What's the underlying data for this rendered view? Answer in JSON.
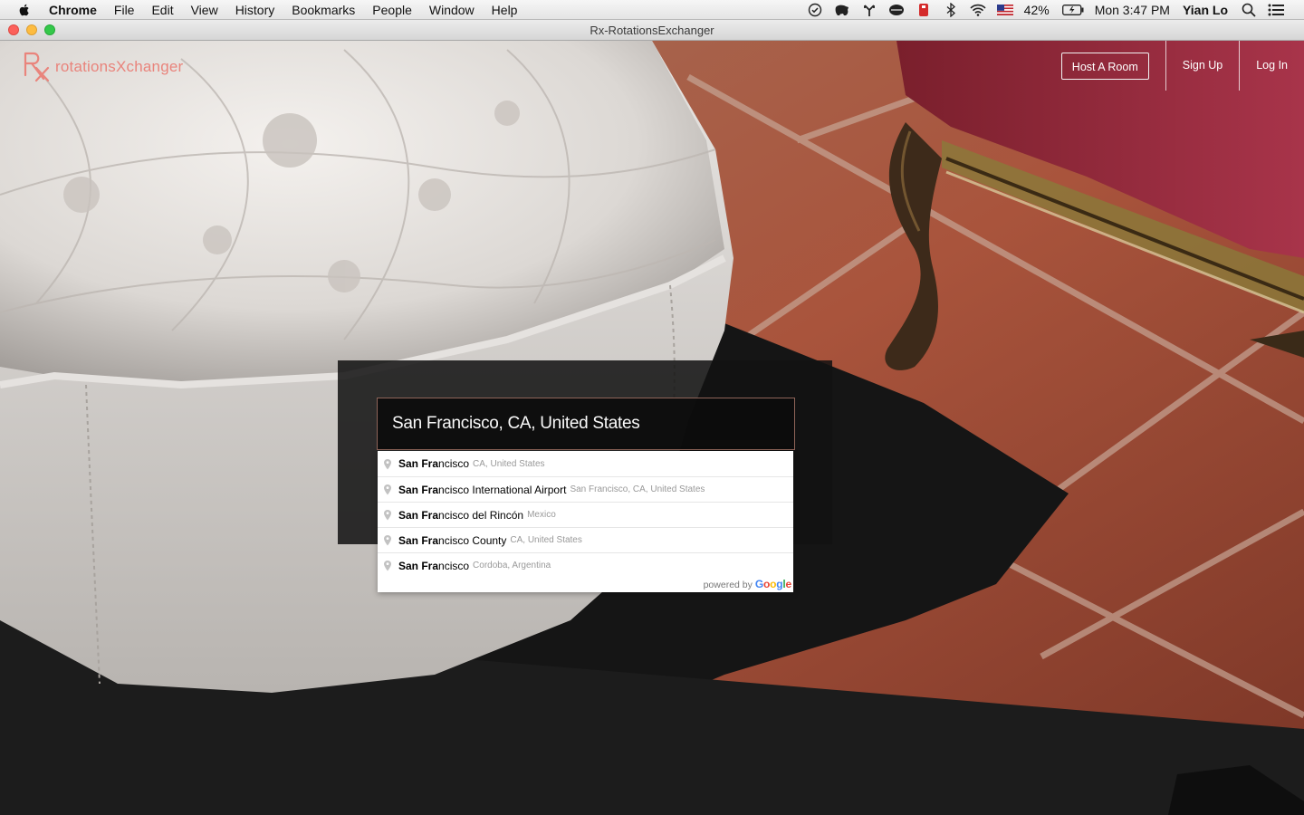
{
  "menubar": {
    "items": [
      "Chrome",
      "File",
      "Edit",
      "View",
      "History",
      "Bookmarks",
      "People",
      "Window",
      "Help"
    ],
    "battery": "42%",
    "clock": "Mon 3:47 PM",
    "user": "Yian Lo"
  },
  "window": {
    "title": "Rx-RotationsExchanger"
  },
  "site": {
    "brand": "rotationsXchanger",
    "nav": {
      "host": "Host A Room",
      "signup": "Sign Up",
      "login": "Log In"
    }
  },
  "search": {
    "value": "San Francisco, CA, United States",
    "suggestions": [
      {
        "match": "San Fra",
        "rest": "ncisco",
        "secondary": "CA, United States"
      },
      {
        "match": "San Fra",
        "rest": "ncisco International Airport",
        "secondary": "San Francisco, CA, United States"
      },
      {
        "match": "San Fra",
        "rest": "ncisco del Rincón",
        "secondary": "Mexico"
      },
      {
        "match": "San Fra",
        "rest": "ncisco County",
        "secondary": "CA, United States"
      },
      {
        "match": "San Fra",
        "rest": "ncisco",
        "secondary": "Cordoba, Argentina"
      }
    ],
    "powered_by": "powered by",
    "google_letters": [
      "G",
      "o",
      "o",
      "g",
      "l",
      "e"
    ]
  },
  "colors": {
    "brand_accent": "#e9847c",
    "input_border": "#8f6459"
  }
}
